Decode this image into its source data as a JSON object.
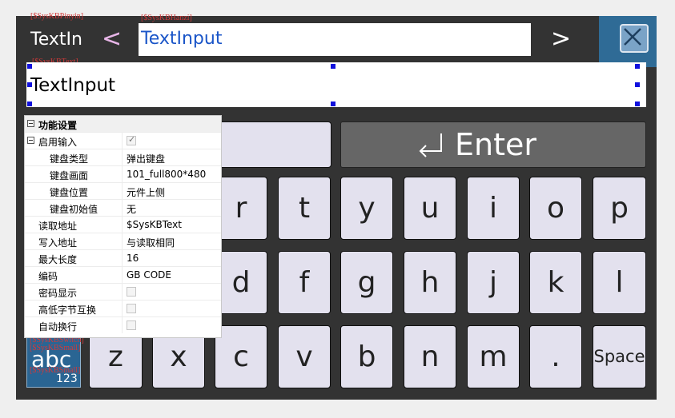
{
  "tags": {
    "pinyin": "[$SysKBPinyin]",
    "hanzi": "[$SysKBHanzi]",
    "text": "[$SysKBText]",
    "stack": "[$SysKBSwitch]",
    "stack2": "[$SysKBSmall]",
    "stack3": "[$SysKBSmall]"
  },
  "header": {
    "pinyin_value": "TextIn",
    "prev_label": "<",
    "next_label": ">",
    "hanzi_value": "TextInput"
  },
  "input": {
    "value": "TextInput"
  },
  "enter": {
    "label": "Enter"
  },
  "keys": {
    "row2": [
      "r",
      "t",
      "y",
      "u",
      "i",
      "o",
      "p"
    ],
    "row3": [
      "d",
      "f",
      "g",
      "h",
      "j",
      "k",
      "l"
    ],
    "row4": [
      "z",
      "x",
      "c",
      "v",
      "b",
      "n",
      "m",
      "."
    ],
    "space": "Space"
  },
  "mode": {
    "main": "abc",
    "sub": "123"
  },
  "panel": {
    "group": "功能设置",
    "rows": [
      {
        "key": "启用输入",
        "value": ""
      },
      {
        "key": "键盘类型",
        "value": "弹出键盘"
      },
      {
        "key": "键盘画面",
        "value": "101_full800*480"
      },
      {
        "key": "键盘位置",
        "value": "元件上侧"
      },
      {
        "key": "键盘初始值",
        "value": "无"
      },
      {
        "key": "读取地址",
        "value": "$SysKBText"
      },
      {
        "key": "写入地址",
        "value": "与读取相同"
      },
      {
        "key": "最大长度",
        "value": "16"
      },
      {
        "key": "编码",
        "value": "GB CODE"
      },
      {
        "key": "密码显示",
        "value": ""
      },
      {
        "key": "高低字节互换",
        "value": ""
      },
      {
        "key": "自动换行",
        "value": ""
      }
    ]
  },
  "colors": {
    "keyboard_bg": "#333333",
    "key_face": "#e3e1ee",
    "hanzi_text": "#1a55c8",
    "close_bg": "#2f6b96",
    "tag_red": "#d23a3a"
  }
}
